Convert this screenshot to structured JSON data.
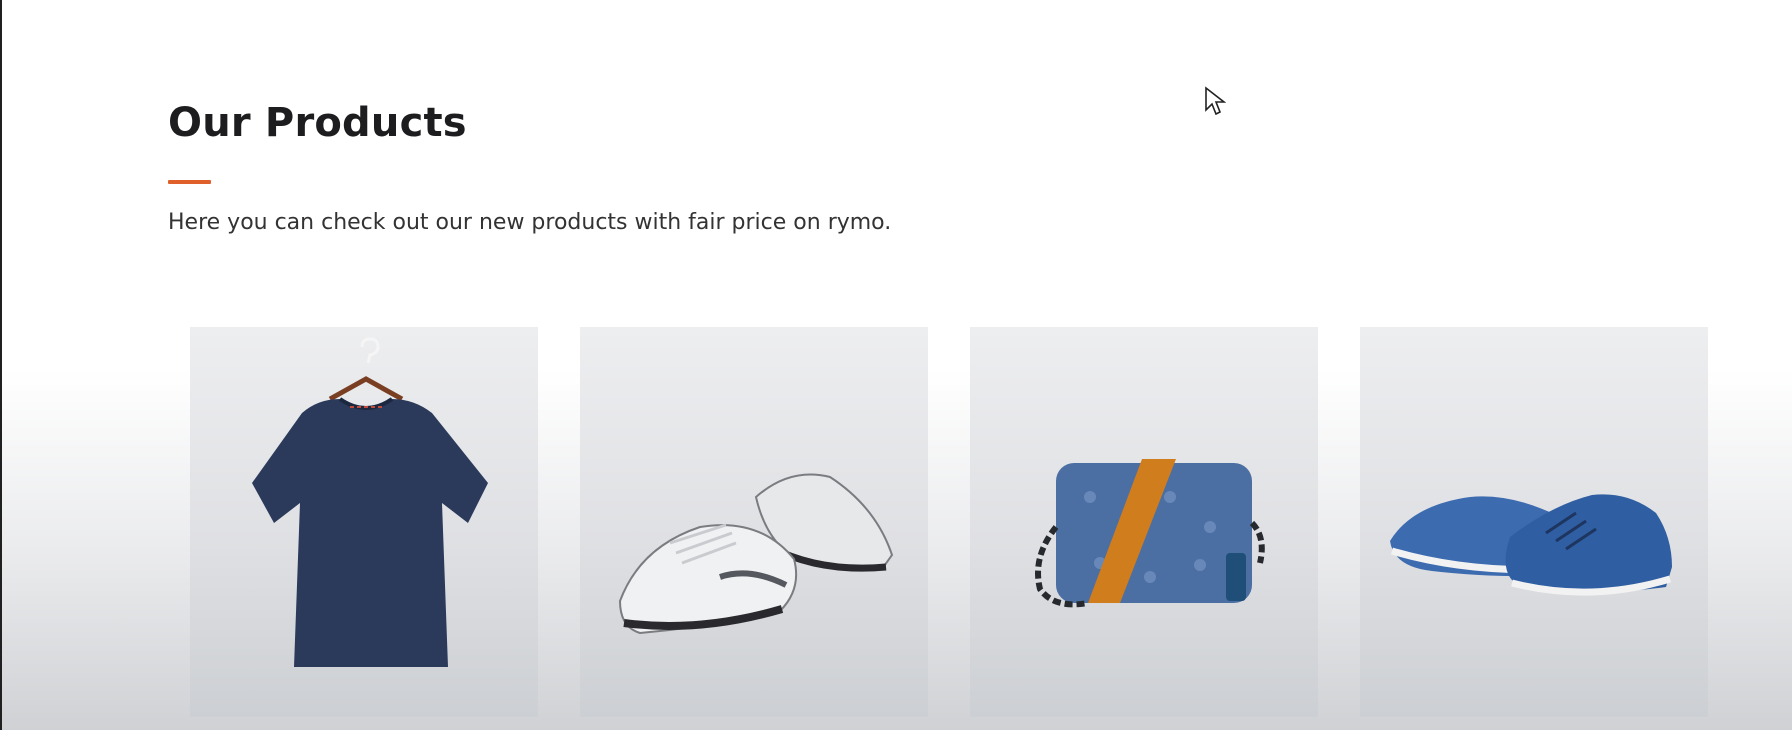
{
  "section": {
    "title": "Our Products",
    "accent_color": "#e0602b",
    "subtitle": "Here you can check out our new products with fair price on rymo."
  },
  "products": [
    {
      "image": "navy-tshirt-on-hanger"
    },
    {
      "image": "white-running-sneakers"
    },
    {
      "image": "blue-crossbody-bag-orange-strap"
    },
    {
      "image": "blue-suede-sneakers"
    }
  ]
}
